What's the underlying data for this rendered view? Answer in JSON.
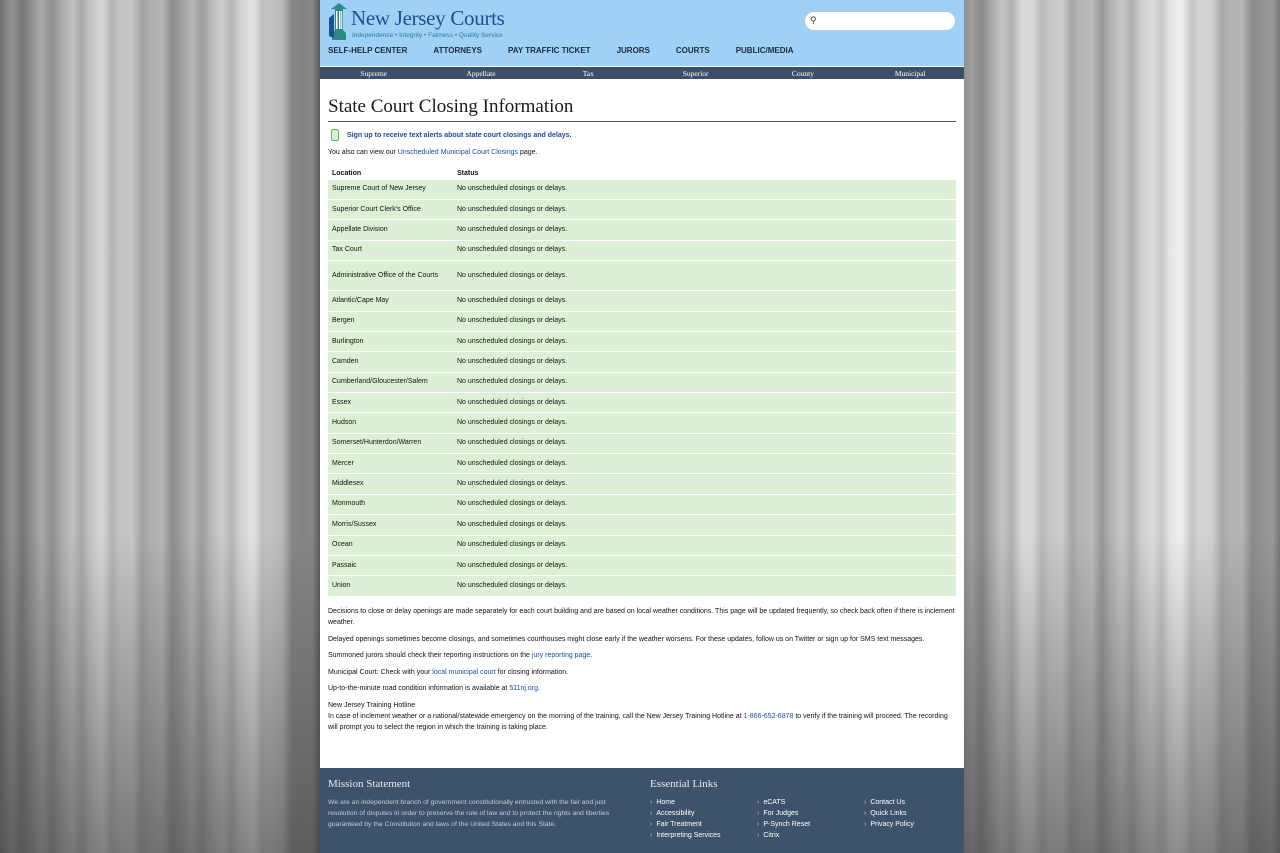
{
  "header": {
    "brand": "New Jersey Courts",
    "tagline": "Independence • Integrity • Fairness • Quality Service",
    "search_placeholder": ""
  },
  "main_nav": [
    "SELF-HELP CENTER",
    "ATTORNEYS",
    "PAY TRAFFIC TICKET",
    "JURORS",
    "COURTS",
    "PUBLIC/MEDIA"
  ],
  "sub_nav": [
    "Supreme",
    "Appellate",
    "Tax",
    "Superior",
    "County",
    "Municipal"
  ],
  "page_title": "State Court Closing Information",
  "alert_link": "Sign up to receive text alerts about state court closings and delays.",
  "view_line": {
    "prefix": "You also can view our ",
    "link": "Unscheduled Municipal Court Closings",
    "suffix": " page."
  },
  "table": {
    "headers": [
      "Location",
      "Status"
    ],
    "rows": [
      {
        "location": "Supreme Court of New Jersey",
        "status": "No unscheduled closings or delays."
      },
      {
        "location": "Superior Court Clerk's Office",
        "status": "No unscheduled closings or delays."
      },
      {
        "location": "Appellate Division",
        "status": "No unscheduled closings or delays."
      },
      {
        "location": "Tax Court",
        "status": "No unscheduled closings or delays."
      },
      {
        "location": "Administrative Office of the Courts",
        "status": "No unscheduled closings or delays."
      },
      {
        "location": "Atlantic/Cape May",
        "status": "No unscheduled closings or delays."
      },
      {
        "location": "Bergen",
        "status": "No unscheduled closings or delays."
      },
      {
        "location": "Burlington",
        "status": "No unscheduled closings or delays."
      },
      {
        "location": "Camden",
        "status": "No unscheduled closings or delays."
      },
      {
        "location": "Cumberland/Gloucester/Salem",
        "status": "No unscheduled closings or delays."
      },
      {
        "location": "Essex",
        "status": "No unscheduled closings or delays."
      },
      {
        "location": "Hudson",
        "status": "No unscheduled closings or delays."
      },
      {
        "location": "Somerset/Hunterdon/Warren",
        "status": "No unscheduled closings or delays."
      },
      {
        "location": "Mercer",
        "status": "No unscheduled closings or delays."
      },
      {
        "location": "Middlesex",
        "status": "No unscheduled closings or delays."
      },
      {
        "location": "Monmouth",
        "status": "No unscheduled closings or delays."
      },
      {
        "location": "Morris/Sussex",
        "status": "No unscheduled closings or delays."
      },
      {
        "location": "Ocean",
        "status": "No unscheduled closings or delays."
      },
      {
        "location": "Passaic",
        "status": "No unscheduled closings or delays."
      },
      {
        "location": "Union",
        "status": "No unscheduled closings or delays."
      }
    ]
  },
  "notes": {
    "p1": "Decisions to close or delay openings are made separately for each court building and are based on local weather conditions. This page will be updated frequently, so check back often if there is inclement weather.",
    "p2": "Delayed openings sometimes become closings, and sometimes courthouses might close early if the weather worsens. For these updates, follow us on Twitter or sign up for SMS text messages.",
    "p3_prefix": "Summoned jurors should check their reporting instructions on the ",
    "p3_link": "jury reporting page",
    "p3_suffix": ".",
    "p4_prefix": "Municipal Court: Check with your ",
    "p4_link": "local municipal court",
    "p4_suffix": " for closing information.",
    "p5_prefix": "Up-to-the-minute road condition information is available at ",
    "p5_link": "511nj.org",
    "p5_suffix": ".",
    "hotline_title": "New Jersey Training Hotline",
    "hotline_prefix": "In case of inclement weather or a national/statewide emergency on the morning of the training, call the New Jersey Training Hotline at ",
    "hotline_phone": "1-866-652-6878",
    "hotline_suffix": " to verify if the training will proceed. The recording will prompt you to select the region in which the training is taking place."
  },
  "footer": {
    "mission_title": "Mission Statement",
    "mission_text": "We are an independent branch of government constitutionally entrusted with the fair and just resolution of disputes in order to preserve the rule of law and to protect the rights and liberties guaranteed by the Constitution and laws of the United States and this State.",
    "links_title": "Essential Links",
    "links": [
      "Home",
      "eCATS",
      "Contact Us",
      "Accessibility",
      "For Judges",
      "Quick Links",
      "Fair Treatment",
      "P-Synch Reset",
      "Privacy Policy",
      "Interpreting Services",
      "Citrix"
    ]
  }
}
